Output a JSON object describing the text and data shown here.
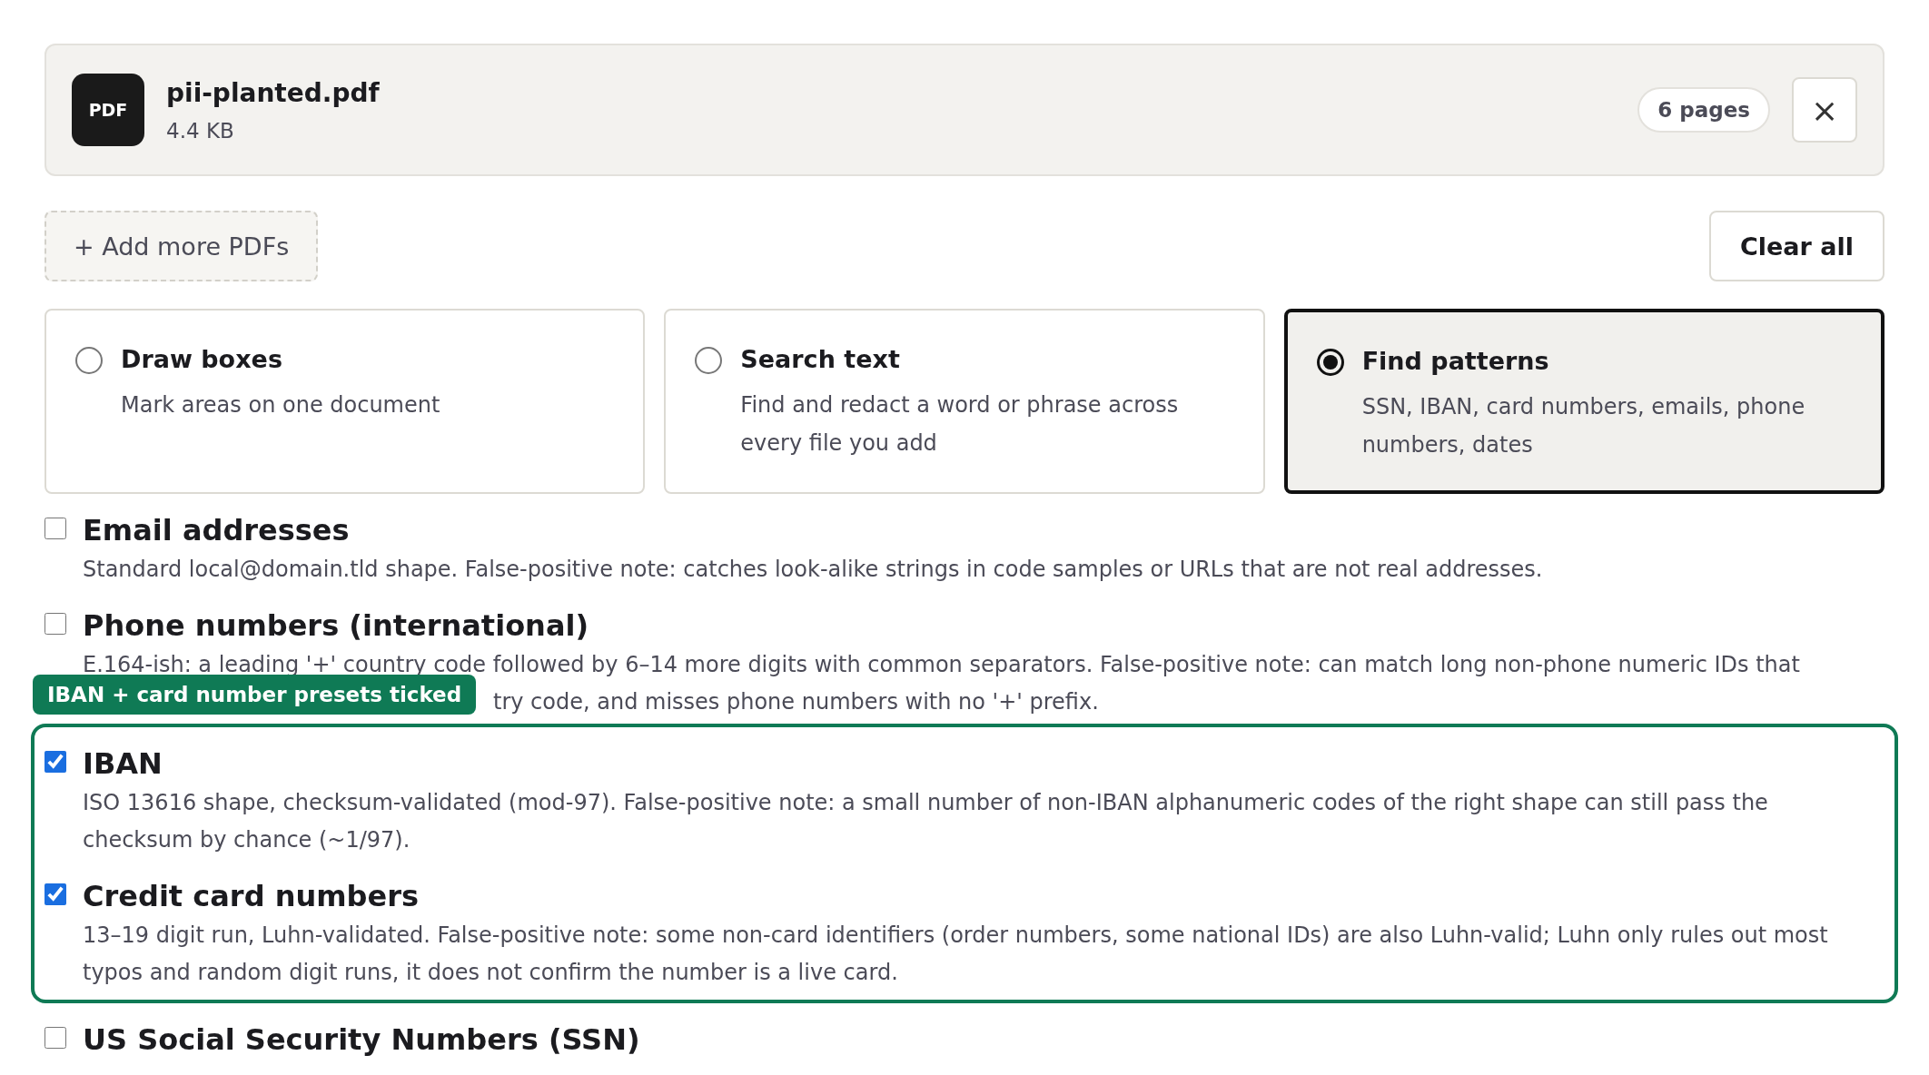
{
  "file": {
    "icon_label": "PDF",
    "name": "pii-planted.pdf",
    "size": "4.4 KB",
    "pages": "6 pages",
    "remove": "×"
  },
  "add_button": "+ Add more PDFs",
  "clear_button": "Clear all",
  "modes": [
    {
      "title": "Draw boxes",
      "description": "Mark areas on one document",
      "selected": false
    },
    {
      "title": "Search text",
      "description": "Find and redact a word or phrase across every file you add",
      "selected": false
    },
    {
      "title": "Find patterns",
      "description": "SSN, IBAN, card numbers, emails, phone numbers, dates",
      "selected": true
    }
  ],
  "patterns_before": [
    {
      "title": "Email addresses",
      "checked": false,
      "lines": [
        "Standard local@domain.tld shape. False-positive note: catches look-alike strings in code samples or URLs that are not real addresses."
      ]
    },
    {
      "title": "Phone numbers (international)",
      "checked": false,
      "lines": [
        "E.164-ish: a leading '+' country code followed by 6–14 more digits with common separators. False-positive note: can match long non-phone numeric IDs that"
      ],
      "covered_line": "try code, and misses phone numbers with no '+' prefix."
    }
  ],
  "highlight": {
    "label": "IBAN + card number presets ticked",
    "patterns": [
      {
        "title": "IBAN",
        "checked": true,
        "lines": [
          "ISO 13616 shape, checksum-validated (mod-97). False-positive note: a small number of non-IBAN alphanumeric codes of the right shape can still pass the",
          "checksum by chance (~1/97)."
        ]
      },
      {
        "title": "Credit card numbers",
        "checked": true,
        "lines": [
          "13–19 digit run, Luhn-validated. False-positive note: some non-card identifiers (order numbers, some national IDs) are also Luhn-valid; Luhn only rules out most",
          "typos and random digit runs, it does not confirm the number is a live card."
        ]
      }
    ]
  },
  "patterns_after": [
    {
      "title": "US Social Security Numbers (SSN)",
      "checked": false
    }
  ]
}
